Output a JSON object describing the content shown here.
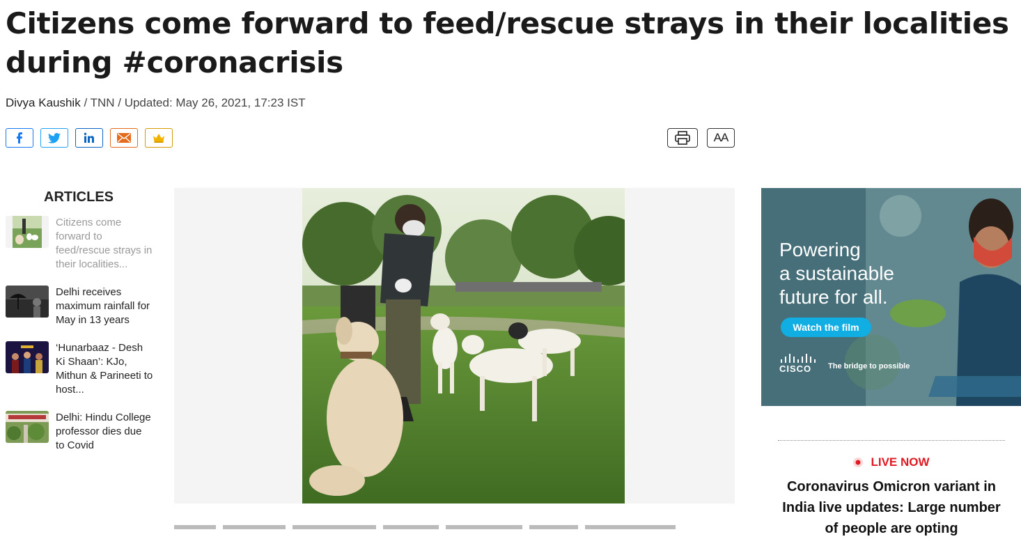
{
  "article": {
    "headline": "Citizens come forward to feed/rescue strays in their localities during #coronacrisis",
    "author": "Divya Kaushik",
    "meta": " / TNN / Updated: May 26, 2021, 17:23 IST"
  },
  "share": {
    "icons": [
      "facebook-icon",
      "twitter-icon",
      "linkedin-icon",
      "mail-icon",
      "crown-icon"
    ]
  },
  "tools": {
    "print_icon": "printer-icon",
    "font_size_label": "AA"
  },
  "sidebar": {
    "title": "ARTICLES",
    "items": [
      {
        "label": "Citizens come forward to feed/rescue strays in their localities...",
        "active": true
      },
      {
        "label": "Delhi receives maximum rainfall for May in 13 years"
      },
      {
        "label": "‘Hunarbaaz - Desh Ki Shaan’: KJo, Mithun & Parineeti to host..."
      },
      {
        "label": "Delhi: Hindu College professor dies due to Covid"
      }
    ]
  },
  "ad": {
    "headline_lines": [
      "Powering",
      "a sustainable",
      "future for all."
    ],
    "button": "Watch the film",
    "brand": "CISCO",
    "tagline": "The bridge to possible"
  },
  "live": {
    "label": "LIVE NOW",
    "headline": "Coronavirus Omicron variant in India live updates: Large number of people are opting"
  },
  "colors": {
    "facebook": "#1877f2",
    "twitter": "#1da1f2",
    "linkedin": "#0a66c2",
    "mail": "#e46b1b",
    "live_red": "#e01a22",
    "ad_button": "#11aee4"
  }
}
